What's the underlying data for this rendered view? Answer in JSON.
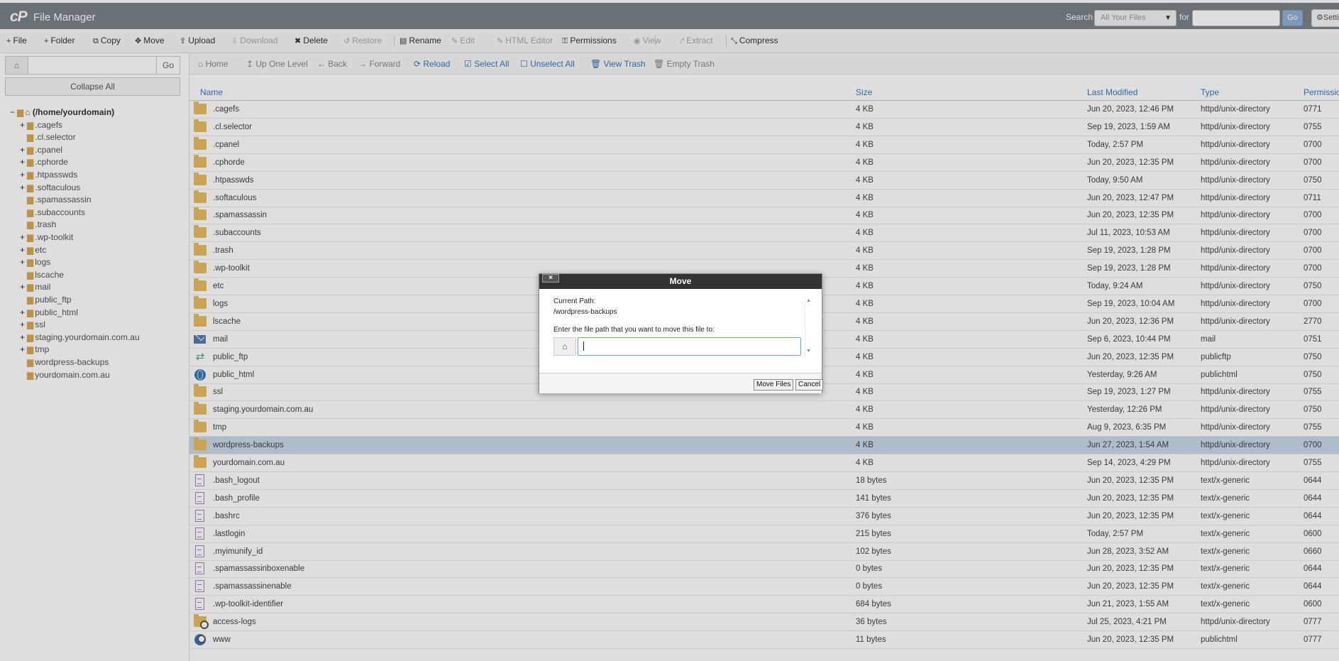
{
  "app": {
    "logo": "cP",
    "title": "File Manager"
  },
  "search": {
    "label": "Search",
    "scope": "All Your Files",
    "for_label": "for",
    "go": "Go",
    "settings": "Settings"
  },
  "toolbar": [
    {
      "name": "file-button",
      "icon": "+",
      "label": "File",
      "enabled": true
    },
    {
      "name": "folder-button",
      "icon": "+",
      "label": "Folder",
      "enabled": true
    },
    {
      "name": "copy-button",
      "icon": "⧉",
      "label": "Copy",
      "enabled": true
    },
    {
      "name": "move-button",
      "icon": "✥",
      "label": "Move",
      "enabled": true
    },
    {
      "name": "upload-button",
      "icon": "⇪",
      "label": "Upload",
      "enabled": true
    },
    {
      "name": "download-button",
      "icon": "⇩",
      "label": "Download",
      "enabled": false
    },
    {
      "name": "delete-button",
      "icon": "✖",
      "label": "Delete",
      "enabled": true
    },
    {
      "name": "restore-button",
      "icon": "↺",
      "label": "Restore",
      "enabled": false
    },
    {
      "name": "rename-button",
      "icon": "▤",
      "label": "Rename",
      "enabled": true
    },
    {
      "name": "edit-button",
      "icon": "✎",
      "label": "Edit",
      "enabled": false
    },
    {
      "name": "html-editor-button",
      "icon": "✎",
      "label": "HTML Editor",
      "enabled": false
    },
    {
      "name": "permissions-button",
      "icon": "⚿",
      "label": "Permissions",
      "enabled": true
    },
    {
      "name": "view-button",
      "icon": "◉",
      "label": "View",
      "enabled": false
    },
    {
      "name": "extract-button",
      "icon": "⤤",
      "label": "Extract",
      "enabled": false
    },
    {
      "name": "compress-button",
      "icon": "⤡",
      "label": "Compress",
      "enabled": true
    }
  ],
  "left": {
    "go": "Go",
    "collapse_all": "Collapse All"
  },
  "tree": [
    {
      "label": "(/home/yourdomain)",
      "root": true,
      "toggle": "−"
    },
    {
      "label": ".cagefs",
      "toggle": "+"
    },
    {
      "label": ".cl.selector",
      "toggle": ""
    },
    {
      "label": ".cpanel",
      "toggle": "+"
    },
    {
      "label": ".cphorde",
      "toggle": "+"
    },
    {
      "label": ".htpasswds",
      "toggle": "+"
    },
    {
      "label": ".softaculous",
      "toggle": "+"
    },
    {
      "label": ".spamassassin",
      "toggle": ""
    },
    {
      "label": ".subaccounts",
      "toggle": ""
    },
    {
      "label": ".trash",
      "toggle": ""
    },
    {
      "label": ".wp-toolkit",
      "toggle": "+"
    },
    {
      "label": "etc",
      "toggle": "+"
    },
    {
      "label": "logs",
      "toggle": "+"
    },
    {
      "label": "lscache",
      "toggle": ""
    },
    {
      "label": "mail",
      "toggle": "+"
    },
    {
      "label": "public_ftp",
      "toggle": ""
    },
    {
      "label": "public_html",
      "toggle": "+"
    },
    {
      "label": "ssl",
      "toggle": "+"
    },
    {
      "label": "staging.yourdomain.com.au",
      "toggle": "+"
    },
    {
      "label": "tmp",
      "toggle": "+"
    },
    {
      "label": "wordpress-backups",
      "toggle": ""
    },
    {
      "label": "yourdomain.com.au",
      "toggle": ""
    }
  ],
  "nav": [
    {
      "name": "home-button",
      "icon": "⌂",
      "label": "Home",
      "active": false
    },
    {
      "name": "up-one-level-button",
      "icon": "↥",
      "label": "Up One Level",
      "active": false
    },
    {
      "name": "back-button",
      "icon": "←",
      "label": "Back",
      "active": false
    },
    {
      "name": "forward-button",
      "icon": "→",
      "label": "Forward",
      "active": false
    },
    {
      "name": "reload-button",
      "icon": "⟳",
      "label": "Reload",
      "active": true
    },
    {
      "name": "select-all-button",
      "icon": "☑",
      "label": "Select All",
      "active": true
    },
    {
      "name": "unselect-all-button",
      "icon": "☐",
      "label": "Unselect All",
      "active": true
    },
    {
      "name": "view-trash-button",
      "icon": "🗑",
      "label": "View Trash",
      "active": true
    },
    {
      "name": "empty-trash-button",
      "icon": "🗑",
      "label": "Empty Trash",
      "active": false
    }
  ],
  "columns": {
    "name": "Name",
    "size": "Size",
    "modified": "Last Modified",
    "type": "Type",
    "perms": "Permissions"
  },
  "files": [
    {
      "name": ".cagefs",
      "size": "4 KB",
      "modified": "Jun 20, 2023, 12:46 PM",
      "type": "httpd/unix-directory",
      "perms": "0771",
      "icon": "folder"
    },
    {
      "name": ".cl.selector",
      "size": "4 KB",
      "modified": "Sep 19, 2023, 1:59 AM",
      "type": "httpd/unix-directory",
      "perms": "0755",
      "icon": "folder"
    },
    {
      "name": ".cpanel",
      "size": "4 KB",
      "modified": "Today, 2:57 PM",
      "type": "httpd/unix-directory",
      "perms": "0700",
      "icon": "folder"
    },
    {
      "name": ".cphorde",
      "size": "4 KB",
      "modified": "Jun 20, 2023, 12:35 PM",
      "type": "httpd/unix-directory",
      "perms": "0700",
      "icon": "folder"
    },
    {
      "name": ".htpasswds",
      "size": "4 KB",
      "modified": "Today, 9:50 AM",
      "type": "httpd/unix-directory",
      "perms": "0750",
      "icon": "folder"
    },
    {
      "name": ".softaculous",
      "size": "4 KB",
      "modified": "Jun 20, 2023, 12:47 PM",
      "type": "httpd/unix-directory",
      "perms": "0711",
      "icon": "folder"
    },
    {
      "name": ".spamassassin",
      "size": "4 KB",
      "modified": "Jun 20, 2023, 12:35 PM",
      "type": "httpd/unix-directory",
      "perms": "0700",
      "icon": "folder"
    },
    {
      "name": ".subaccounts",
      "size": "4 KB",
      "modified": "Jul 11, 2023, 10:53 AM",
      "type": "httpd/unix-directory",
      "perms": "0700",
      "icon": "folder"
    },
    {
      "name": ".trash",
      "size": "4 KB",
      "modified": "Sep 19, 2023, 1:28 PM",
      "type": "httpd/unix-directory",
      "perms": "0700",
      "icon": "folder"
    },
    {
      "name": ".wp-toolkit",
      "size": "4 KB",
      "modified": "Sep 19, 2023, 1:28 PM",
      "type": "httpd/unix-directory",
      "perms": "0700",
      "icon": "folder"
    },
    {
      "name": "etc",
      "size": "4 KB",
      "modified": "Today, 9:24 AM",
      "type": "httpd/unix-directory",
      "perms": "0750",
      "icon": "folder"
    },
    {
      "name": "logs",
      "size": "4 KB",
      "modified": "Sep 19, 2023, 10:04 AM",
      "type": "httpd/unix-directory",
      "perms": "0700",
      "icon": "folder"
    },
    {
      "name": "lscache",
      "size": "4 KB",
      "modified": "Jun 20, 2023, 12:36 PM",
      "type": "httpd/unix-directory",
      "perms": "2770",
      "icon": "folder"
    },
    {
      "name": "mail",
      "size": "4 KB",
      "modified": "Sep 6, 2023, 10:44 PM",
      "type": "mail",
      "perms": "0751",
      "icon": "mail"
    },
    {
      "name": "public_ftp",
      "size": "4 KB",
      "modified": "Jun 20, 2023, 12:35 PM",
      "type": "publicftp",
      "perms": "0750",
      "icon": "ftp"
    },
    {
      "name": "public_html",
      "size": "4 KB",
      "modified": "Yesterday, 9:26 AM",
      "type": "publichtml",
      "perms": "0750",
      "icon": "globe"
    },
    {
      "name": "ssl",
      "size": "4 KB",
      "modified": "Sep 19, 2023, 1:27 PM",
      "type": "httpd/unix-directory",
      "perms": "0755",
      "icon": "folder"
    },
    {
      "name": "staging.yourdomain.com.au",
      "size": "4 KB",
      "modified": "Yesterday, 12:26 PM",
      "type": "httpd/unix-directory",
      "perms": "0750",
      "icon": "folder"
    },
    {
      "name": "tmp",
      "size": "4 KB",
      "modified": "Aug 9, 2023, 6:35 PM",
      "type": "httpd/unix-directory",
      "perms": "0755",
      "icon": "folder"
    },
    {
      "name": "wordpress-backups",
      "size": "4 KB",
      "modified": "Jun 27, 2023, 1:54 AM",
      "type": "httpd/unix-directory",
      "perms": "0700",
      "icon": "folder",
      "selected": true
    },
    {
      "name": "yourdomain.com.au",
      "size": "4 KB",
      "modified": "Sep 14, 2023, 4:29 PM",
      "type": "httpd/unix-directory",
      "perms": "0755",
      "icon": "folder"
    },
    {
      "name": ".bash_logout",
      "size": "18 bytes",
      "modified": "Jun 20, 2023, 12:35 PM",
      "type": "text/x-generic",
      "perms": "0644",
      "icon": "file"
    },
    {
      "name": ".bash_profile",
      "size": "141 bytes",
      "modified": "Jun 20, 2023, 12:35 PM",
      "type": "text/x-generic",
      "perms": "0644",
      "icon": "file"
    },
    {
      "name": ".bashrc",
      "size": "376 bytes",
      "modified": "Jun 20, 2023, 12:35 PM",
      "type": "text/x-generic",
      "perms": "0644",
      "icon": "file"
    },
    {
      "name": ".lastlogin",
      "size": "215 bytes",
      "modified": "Today, 2:57 PM",
      "type": "text/x-generic",
      "perms": "0600",
      "icon": "file"
    },
    {
      "name": ".myimunify_id",
      "size": "102 bytes",
      "modified": "Jun 28, 2023, 3:52 AM",
      "type": "text/x-generic",
      "perms": "0660",
      "icon": "file"
    },
    {
      "name": ".spamassassinboxenable",
      "size": "0 bytes",
      "modified": "Jun 20, 2023, 12:35 PM",
      "type": "text/x-generic",
      "perms": "0644",
      "icon": "file"
    },
    {
      "name": ".spamassassinenable",
      "size": "0 bytes",
      "modified": "Jun 20, 2023, 12:35 PM",
      "type": "text/x-generic",
      "perms": "0644",
      "icon": "file"
    },
    {
      "name": ".wp-toolkit-identifier",
      "size": "684 bytes",
      "modified": "Jun 21, 2023, 1:55 AM",
      "type": "text/x-generic",
      "perms": "0600",
      "icon": "file"
    },
    {
      "name": "access-logs",
      "size": "36 bytes",
      "modified": "Jul 25, 2023, 4:21 PM",
      "type": "httpd/unix-directory",
      "perms": "0777",
      "icon": "folderlink"
    },
    {
      "name": "www",
      "size": "11 bytes",
      "modified": "Jun 20, 2023, 12:35 PM",
      "type": "publichtml",
      "perms": "0777",
      "icon": "globelink"
    }
  ],
  "dialog": {
    "title": "Move",
    "close": "×",
    "current_path_label": "Current Path:",
    "current_path": "/wordpress-backups",
    "prompt": "Enter the file path that you want to move this file to:",
    "value": "",
    "move_button": "Move Files",
    "cancel_button": "Cancel"
  }
}
